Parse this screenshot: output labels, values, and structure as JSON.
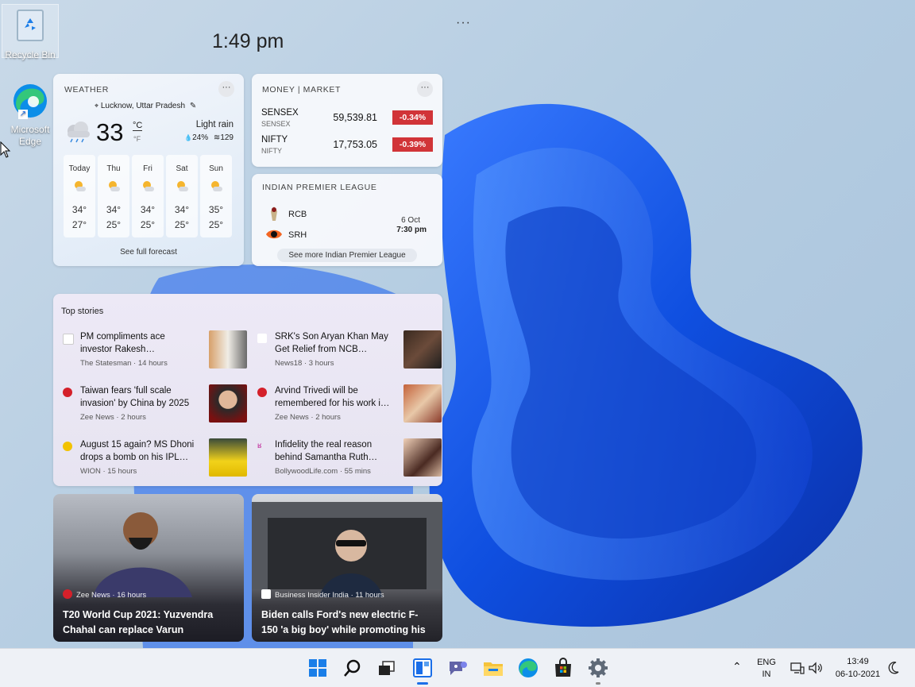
{
  "desktop": {
    "icons": [
      {
        "label": "Recycle Bin",
        "icon": "recycle-bin-icon"
      },
      {
        "label": "Microsoft Edge",
        "icon": "edge-icon"
      }
    ]
  },
  "widgets_panel": {
    "time": "1:49 pm",
    "more": "···"
  },
  "weather": {
    "title": "WEATHER",
    "location": "Lucknow, Uttar Pradesh",
    "temperature": "33",
    "unit_c": "°C",
    "unit_f": "°F",
    "condition": "Light rain",
    "precip": "24%",
    "aqi": "129",
    "forecast": [
      {
        "day": "Today",
        "high": "34°",
        "low": "27°"
      },
      {
        "day": "Thu",
        "high": "34°",
        "low": "25°"
      },
      {
        "day": "Fri",
        "high": "34°",
        "low": "25°"
      },
      {
        "day": "Sat",
        "high": "34°",
        "low": "25°"
      },
      {
        "day": "Sun",
        "high": "35°",
        "low": "25°"
      }
    ],
    "link": "See full forecast"
  },
  "market": {
    "title": "MONEY | MARKET",
    "rows": [
      {
        "name": "SENSEX",
        "sub": "SENSEX",
        "value": "59,539.81",
        "change": "-0.34%"
      },
      {
        "name": "NIFTY",
        "sub": "NIFTY",
        "value": "17,753.05",
        "change": "-0.39%"
      }
    ],
    "colors": {
      "negative": "#d13438"
    }
  },
  "ipl": {
    "title": "INDIAN PREMIER LEAGUE",
    "team1": "RCB",
    "team2": "SRH",
    "date": "6 Oct",
    "time": "7:30 pm",
    "link": "See more Indian Premier League"
  },
  "top_stories": {
    "title": "Top stories",
    "items": [
      {
        "headline": "PM compliments ace investor Rakesh…",
        "source": "The Statesman · 14 hours"
      },
      {
        "headline": "SRK's Son Aryan Khan May Get Relief from NCB…",
        "source": "News18 · 3 hours"
      },
      {
        "headline": "Taiwan fears 'full scale invasion' by China by 2025",
        "source": "Zee News · 2 hours"
      },
      {
        "headline": "Arvind Trivedi will be remembered for his work i…",
        "source": "Zee News · 2 hours"
      },
      {
        "headline": "August 15 again? MS Dhoni drops a bomb on his IPL…",
        "source": "WION · 15 hours"
      },
      {
        "headline": "Infidelity the real reason behind Samantha Ruth…",
        "source": "BollywoodLife.com · 55 mins"
      }
    ]
  },
  "feature_cards": [
    {
      "source": "Zee News · 16 hours",
      "headline": "T20 World Cup 2021: Yuzvendra Chahal can replace Varun"
    },
    {
      "source": "Business Insider India · 11 hours",
      "headline": "Biden calls Ford's new electric F-150 'a big boy' while promoting his"
    }
  ],
  "taskbar": {
    "apps": [
      "windows-start-icon",
      "search-icon",
      "task-view-icon",
      "widgets-icon",
      "teams-chat-icon",
      "file-explorer-icon",
      "edge-icon",
      "store-icon",
      "settings-icon"
    ],
    "lang_top": "ENG",
    "lang_bottom": "IN",
    "time": "13:49",
    "date": "06-10-2021"
  }
}
